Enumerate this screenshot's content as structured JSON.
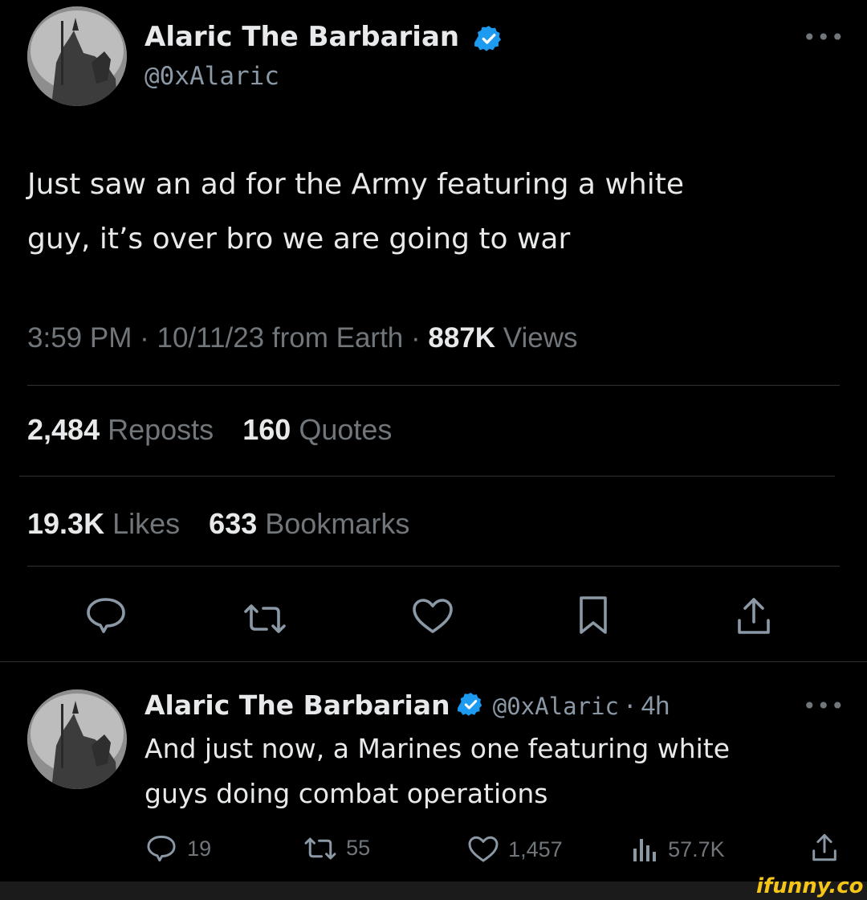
{
  "main_tweet": {
    "author_name": "Alaric The Barbarian",
    "handle": "@0xAlaric",
    "more_label": "•••",
    "text_line1": "Just saw an ad for the Army featuring a white",
    "text_line2": "guy, it’s over bro we are going to war",
    "time": "3:59 PM",
    "date": "10/11/23",
    "source": "from Earth",
    "views_count": "887K",
    "views_label": "Views",
    "reposts_count": "2,484",
    "reposts_label": "Reposts",
    "quotes_count": "160",
    "quotes_label": "Quotes",
    "likes_count": "19.3K",
    "likes_label": "Likes",
    "bookmarks_count": "633",
    "bookmarks_label": "Bookmarks",
    "action_icons": [
      "reply-icon",
      "repost-icon",
      "like-icon",
      "bookmark-icon",
      "share-icon"
    ]
  },
  "reply_tweet": {
    "author_name": "Alaric The Barbarian",
    "handle": "@0xAlaric",
    "age": "4h",
    "more_label": "•••",
    "text_line1": "And just now, a Marines one featuring white",
    "text_line2": "guys doing combat operations",
    "replies": "19",
    "reposts": "55",
    "likes": "1,457",
    "views": "57.7K"
  },
  "watermark": "ifunny.co",
  "colors": {
    "background": "#000000",
    "text": "#e7e9ea",
    "muted": "#71767b",
    "verified": "#1d9bf0",
    "watermark": "#f5c518"
  }
}
